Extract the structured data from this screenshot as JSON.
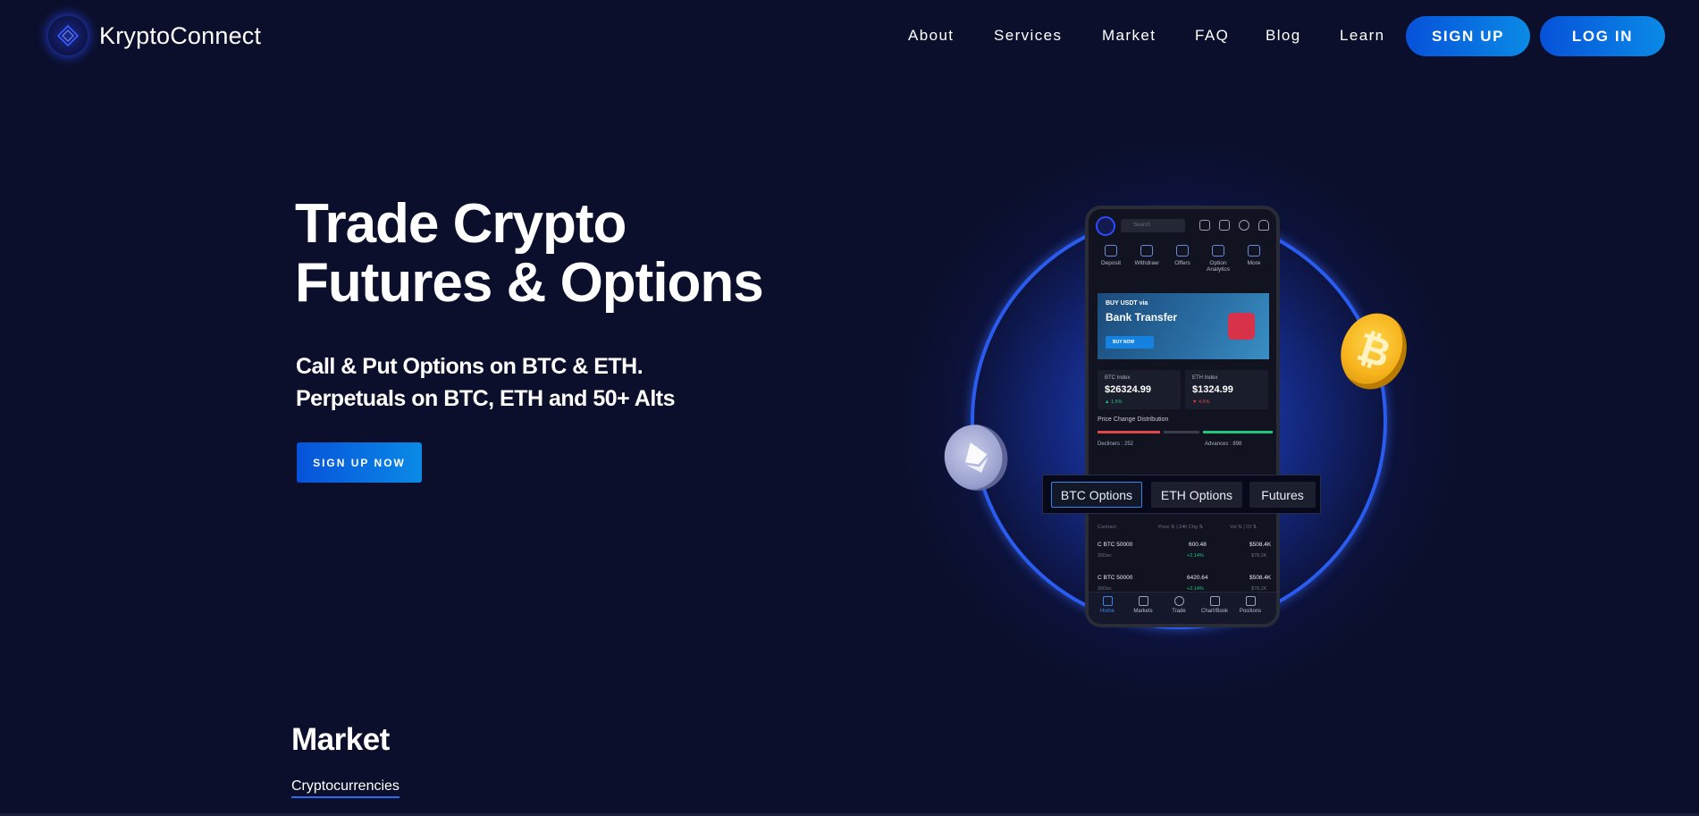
{
  "brand": {
    "name": "KryptoConnect"
  },
  "nav": {
    "links": [
      "About",
      "Services",
      "Market",
      "FAQ",
      "Blog",
      "Learn"
    ],
    "signup": "SIGN UP",
    "login": "LOG IN"
  },
  "hero": {
    "title_line1": "Trade Crypto",
    "title_line2": "Futures & Options",
    "subtitle_line1": "Call & Put Options on BTC & ETH.",
    "subtitle_line2": "Perpetuals on BTC, ETH and 50+ Alts",
    "cta": "SIGN UP NOW"
  },
  "phone": {
    "search_placeholder": "Search",
    "quick_actions": [
      "Deposit",
      "Withdraw",
      "Offers",
      "Option Analytics",
      "More"
    ],
    "banner": {
      "line1": "BUY USDT via",
      "line2": "Bank Transfer",
      "button": "BUY NOW"
    },
    "btc_index": {
      "label": "BTC Index",
      "value": "$26324.99",
      "change": "▲ 1.5%"
    },
    "eth_index": {
      "label": "ETH Index",
      "value": "$1324.99",
      "change": "▼ 4.5%"
    },
    "distribution_title": "Price Change Distribution",
    "decliners": "Decliners : 252",
    "advances": "Advances : 898",
    "table_head": [
      "Contract",
      "Price ⇅ | 24h Chg ⇅",
      "Vol ⇅ | OI ⇅"
    ],
    "rows": [
      {
        "contract": "C BTC 50000",
        "date": "30Dec",
        "price": "600.48",
        "chg": "+2.14%",
        "vol": "$508.4K",
        "oi": "$78.2K"
      },
      {
        "contract": "C BTC 50000",
        "date": "30Dec",
        "price": "6420.64",
        "chg": "+2.14%",
        "vol": "$508.4K",
        "oi": "$78.2K"
      }
    ],
    "bottom_nav": [
      "Home",
      "Markets",
      "Trade",
      "Chart/Book",
      "Positions"
    ]
  },
  "tabs": [
    "BTC Options",
    "ETH Options",
    "Futures"
  ],
  "market": {
    "title": "Market",
    "tab": "Cryptocurrencies"
  },
  "colors": {
    "background": "#0b0f2b",
    "accent": "#0a8ae6",
    "ring": "#2a5cf0",
    "positive": "#1fc77e",
    "negative": "#e04848"
  }
}
